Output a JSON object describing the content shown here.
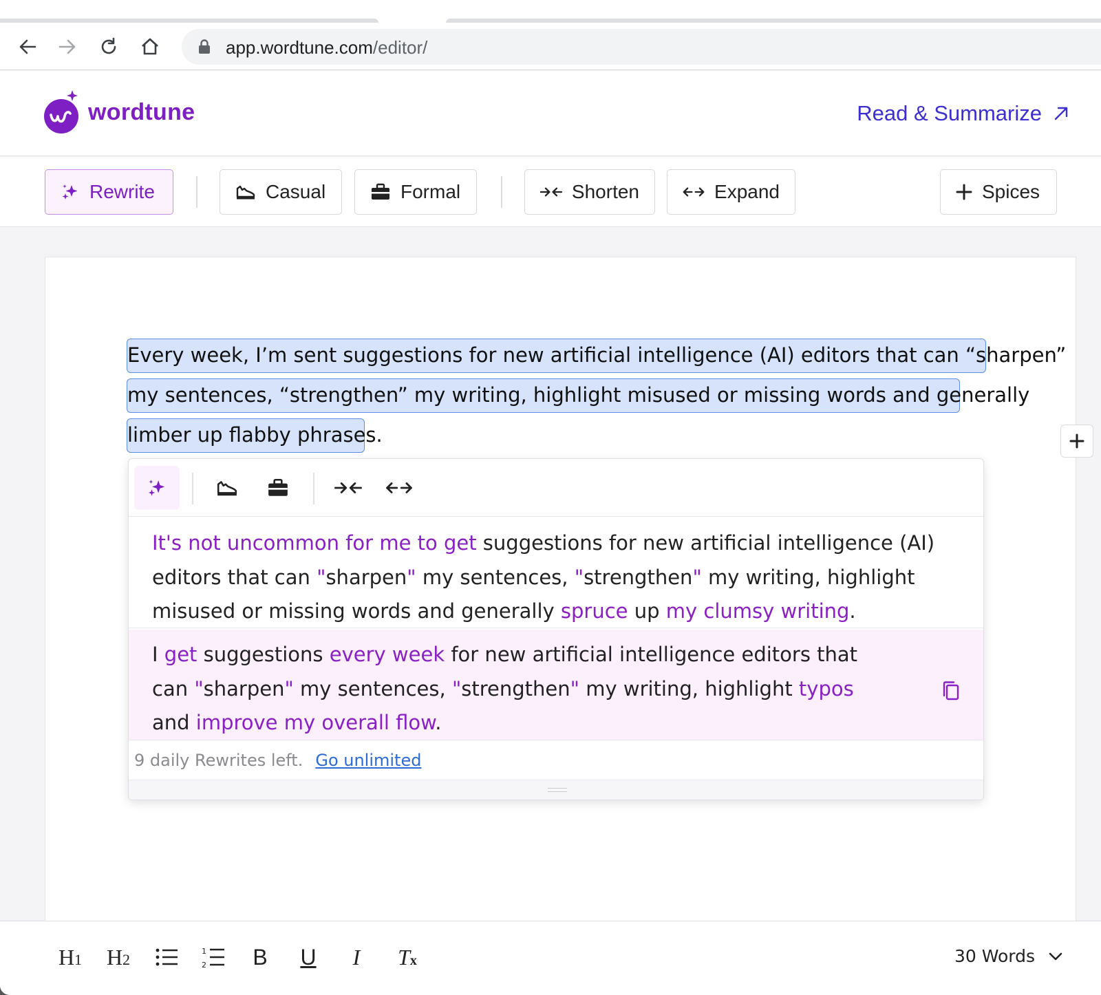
{
  "browser": {
    "url_host": "app.wordtune.com",
    "url_path": "/editor/"
  },
  "header": {
    "brand": "wordtune",
    "read_summarize": "Read & Summarize"
  },
  "modes": {
    "rewrite": "Rewrite",
    "casual": "Casual",
    "formal": "Formal",
    "shorten": "Shorten",
    "expand": "Expand",
    "spices": "Spices"
  },
  "editor": {
    "lines": [
      "Every week, I’m sent suggestions for new artificial intelligence (AI) editors that can “sharpen”",
      "my sentences, “strengthen” my writing, highlight misused or missing words and generally",
      "limber up flabby phrases."
    ]
  },
  "popup": {
    "suggestion_1": [
      {
        "t": "It's not uncommon for me to get",
        "hl": true
      },
      {
        "t": " suggestions for new artificial intelligence (AI) editors that can ",
        "hl": false
      },
      {
        "t": "\"",
        "hl": true
      },
      {
        "t": "sharpen",
        "hl": false
      },
      {
        "t": "\"",
        "hl": true
      },
      {
        "t": " my sentences, ",
        "hl": false
      },
      {
        "t": "\"",
        "hl": true
      },
      {
        "t": "strengthen",
        "hl": false
      },
      {
        "t": "\"",
        "hl": true
      },
      {
        "t": " my writing, highlight misused or missing words and generally ",
        "hl": false
      },
      {
        "t": "spruce",
        "hl": true
      },
      {
        "t": " up ",
        "hl": false
      },
      {
        "t": "my clumsy writing",
        "hl": true
      },
      {
        "t": ".",
        "hl": false
      }
    ],
    "suggestion_2": [
      {
        "t": "I ",
        "hl": false
      },
      {
        "t": "get",
        "hl": true
      },
      {
        "t": " suggestions ",
        "hl": false
      },
      {
        "t": "every week",
        "hl": true
      },
      {
        "t": " for new artificial intelligence editors that can ",
        "hl": false
      },
      {
        "t": "\"",
        "hl": true
      },
      {
        "t": "sharpen",
        "hl": false
      },
      {
        "t": "\"",
        "hl": true
      },
      {
        "t": " my sentences, ",
        "hl": false
      },
      {
        "t": "\"",
        "hl": true
      },
      {
        "t": "strengthen",
        "hl": false
      },
      {
        "t": "\"",
        "hl": true
      },
      {
        "t": " my writing, highlight ",
        "hl": false
      },
      {
        "t": "typos",
        "hl": true
      },
      {
        "t": " and ",
        "hl": false
      },
      {
        "t": "improve my overall flow",
        "hl": true
      },
      {
        "t": ".",
        "hl": false
      }
    ],
    "rewrites_left": "9 daily Rewrites left.",
    "go_unlimited": "Go unlimited"
  },
  "format_bar": {
    "h1": "H",
    "h1_sub": "1",
    "h2": "H",
    "h2_sub": "2",
    "bold": "B",
    "underline": "U",
    "italic": "I",
    "clear": "T",
    "clear_sub": "x",
    "word_count": "30 Words"
  },
  "colors": {
    "brand_purple": "#7d1fc2",
    "link_blue": "#3d2fcf",
    "selection": "#d6e3fb",
    "suggestion_highlight": "#8a1fc4"
  }
}
